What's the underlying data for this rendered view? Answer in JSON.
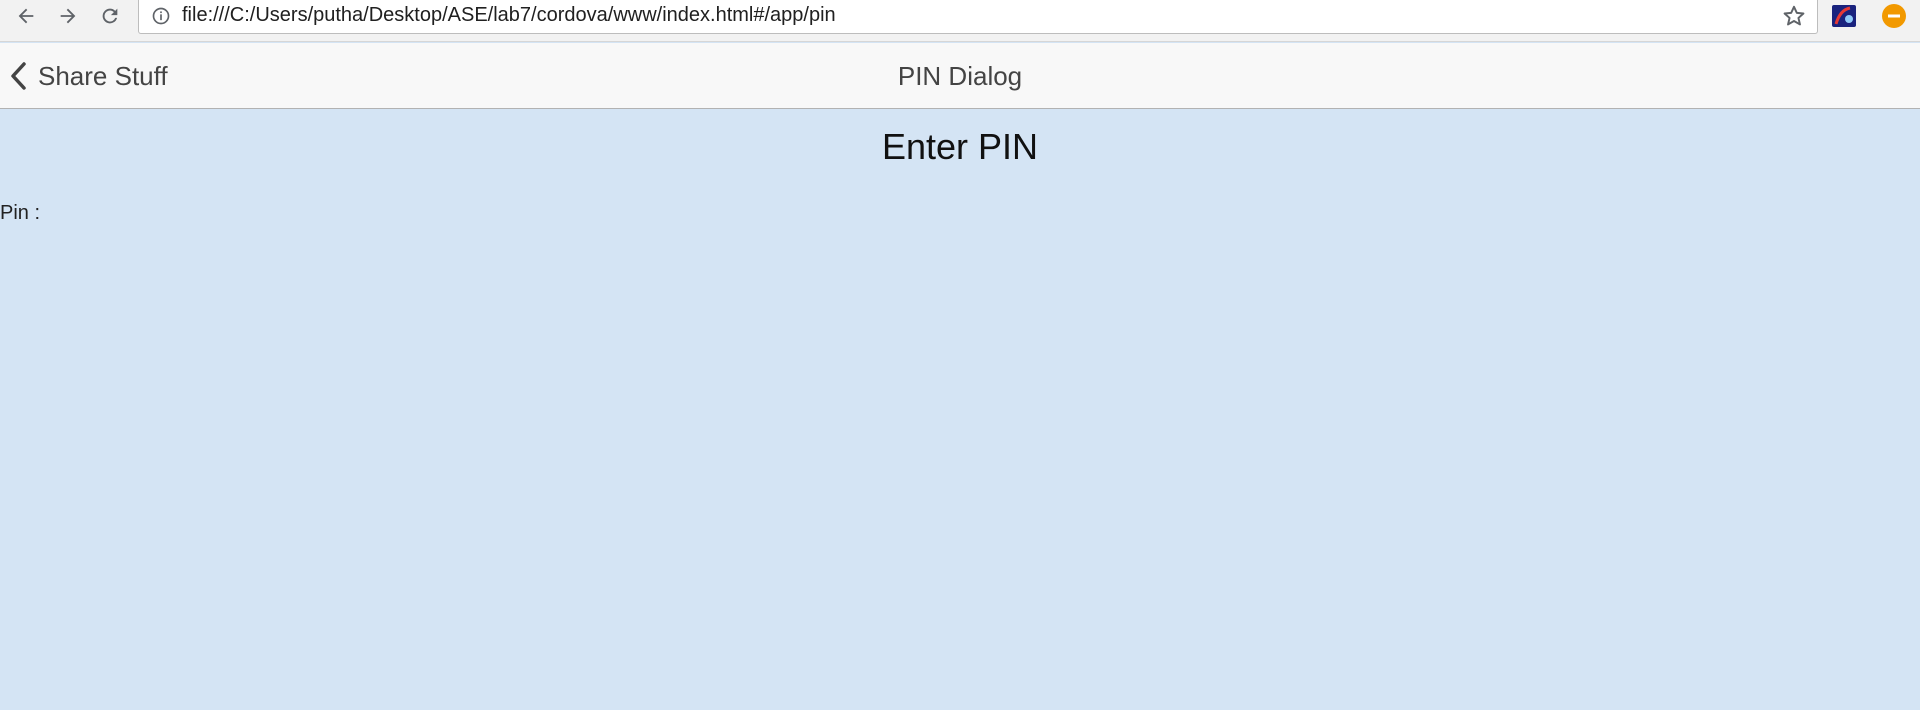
{
  "browser": {
    "url": "file:///C:/Users/putha/Desktop/ASE/lab7/cordova/www/index.html#/app/pin",
    "icons": {
      "back": "back-arrow-icon",
      "forward": "forward-arrow-icon",
      "reload": "reload-icon",
      "info": "info-icon",
      "bookmark": "star-icon",
      "extension": "extension-icon",
      "menu": "orange-minus-icon"
    },
    "colors": {
      "menu_icon": "#f29900"
    }
  },
  "header": {
    "back_label": "Share Stuff",
    "title": "PIN Dialog"
  },
  "main": {
    "heading": "Enter PIN",
    "pin_label": "Pin :"
  },
  "colors": {
    "content_background": "#d4e4f4",
    "header_background": "#f8f8f8"
  }
}
